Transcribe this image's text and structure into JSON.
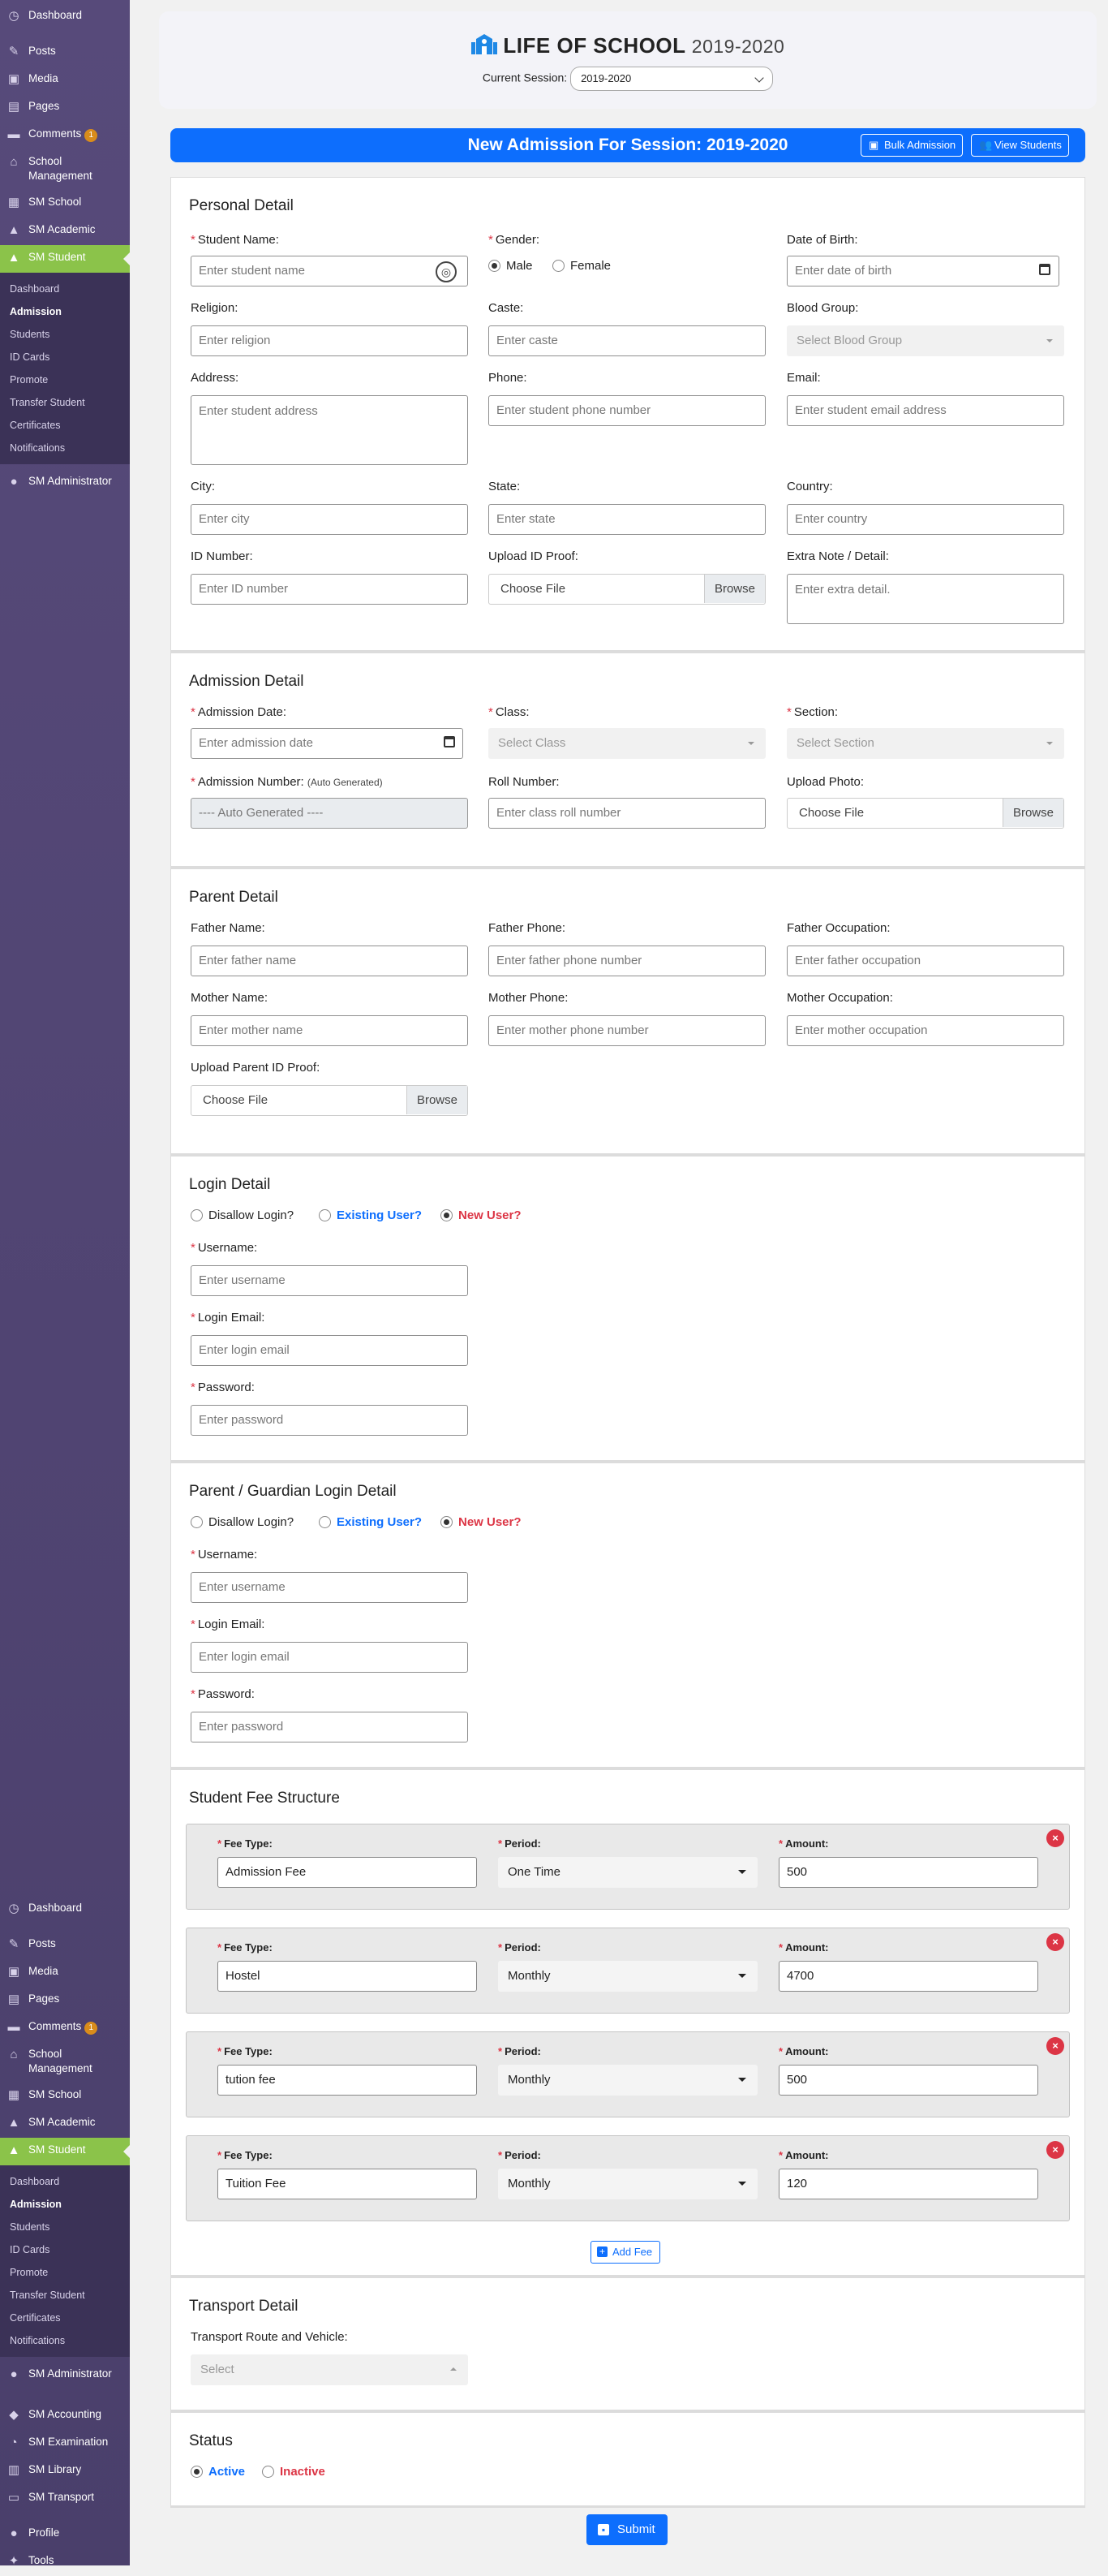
{
  "sidebar": {
    "top_items": [
      {
        "icon": "dashboard-icon",
        "label": "Dashboard"
      },
      {
        "icon": "pin-icon",
        "label": "Posts"
      },
      {
        "icon": "media-icon",
        "label": "Media"
      },
      {
        "icon": "pages-icon",
        "label": "Pages"
      },
      {
        "icon": "comments-icon",
        "label": "Comments",
        "badge": "1"
      },
      {
        "icon": "school-icon",
        "label": "School Management"
      },
      {
        "icon": "building-icon",
        "label": "SM School"
      },
      {
        "icon": "graduation-icon",
        "label": "SM Academic"
      },
      {
        "icon": "graduation-icon",
        "label": "SM Student"
      }
    ],
    "student_sub": [
      "Dashboard",
      "Admission",
      "Students",
      "ID Cards",
      "Promote",
      "Transfer Student",
      "Certificates",
      "Notifications"
    ],
    "admin": {
      "icon": "user-icon",
      "label": "SM Administrator"
    },
    "bottom_extra": [
      {
        "icon": "accounting-icon",
        "label": "SM Accounting"
      },
      {
        "icon": "clock-icon",
        "label": "SM Examination"
      },
      {
        "icon": "library-icon",
        "label": "SM Library"
      },
      {
        "icon": "bus-icon",
        "label": "SM Transport"
      },
      {
        "icon": "profile-icon",
        "label": "Profile"
      },
      {
        "icon": "wrench-icon",
        "label": "Tools"
      }
    ]
  },
  "header": {
    "school": "LIFE OF SCHOOL",
    "year": "2019-2020",
    "session_label": "Current Session:",
    "session_value": "2019-2020"
  },
  "banner": {
    "title": "New Admission For Session: 2019-2020",
    "bulk_label": "Bulk Admission",
    "view_label": "View Students"
  },
  "personal": {
    "title": "Personal Detail",
    "student_name": {
      "label": "Student Name:",
      "placeholder": "Enter student name"
    },
    "gender": {
      "label": "Gender:",
      "male": "Male",
      "female": "Female",
      "selected": "Male"
    },
    "dob": {
      "label": "Date of Birth:",
      "placeholder": "Enter date of birth"
    },
    "religion": {
      "label": "Religion:",
      "placeholder": "Enter religion"
    },
    "caste": {
      "label": "Caste:",
      "placeholder": "Enter caste"
    },
    "blood": {
      "label": "Blood Group:",
      "placeholder": "Select Blood Group"
    },
    "address": {
      "label": "Address:",
      "placeholder": "Enter student address"
    },
    "phone": {
      "label": "Phone:",
      "placeholder": "Enter student phone number"
    },
    "email": {
      "label": "Email:",
      "placeholder": "Enter student email address"
    },
    "city": {
      "label": "City:",
      "placeholder": "Enter city"
    },
    "state": {
      "label": "State:",
      "placeholder": "Enter state"
    },
    "country": {
      "label": "Country:",
      "placeholder": "Enter country"
    },
    "id_number": {
      "label": "ID Number:",
      "placeholder": "Enter ID number"
    },
    "id_proof": {
      "label": "Upload ID Proof:",
      "choose": "Choose File",
      "browse": "Browse"
    },
    "note": {
      "label": "Extra Note / Detail:",
      "placeholder": "Enter extra detail."
    }
  },
  "admission": {
    "title": "Admission Detail",
    "date": {
      "label": "Admission Date:",
      "placeholder": "Enter admission date"
    },
    "class": {
      "label": "Class:",
      "placeholder": "Select Class"
    },
    "section": {
      "label": "Section:",
      "placeholder": "Select Section"
    },
    "number": {
      "label": "Admission Number:",
      "note": "(Auto Generated)",
      "value": "---- Auto Generated ----"
    },
    "roll": {
      "label": "Roll Number:",
      "placeholder": "Enter class roll number"
    },
    "photo": {
      "label": "Upload Photo:",
      "choose": "Choose File",
      "browse": "Browse"
    }
  },
  "parent": {
    "title": "Parent Detail",
    "father_name": {
      "label": "Father Name:",
      "placeholder": "Enter father name"
    },
    "father_phone": {
      "label": "Father Phone:",
      "placeholder": "Enter father phone number"
    },
    "father_occ": {
      "label": "Father Occupation:",
      "placeholder": "Enter father occupation"
    },
    "mother_name": {
      "label": "Mother Name:",
      "placeholder": "Enter mother name"
    },
    "mother_phone": {
      "label": "Mother Phone:",
      "placeholder": "Enter mother phone number"
    },
    "mother_occ": {
      "label": "Mother Occupation:",
      "placeholder": "Enter mother occupation"
    },
    "id_proof": {
      "label": "Upload Parent ID Proof:",
      "choose": "Choose File",
      "browse": "Browse"
    }
  },
  "login": {
    "title": "Login Detail",
    "opt_disallow": "Disallow Login?",
    "opt_existing": "Existing User?",
    "opt_new": "New User?",
    "selected": "New User?",
    "username": {
      "label": "Username:",
      "placeholder": "Enter username"
    },
    "login_email": {
      "label": "Login Email:",
      "placeholder": "Enter login email"
    },
    "password": {
      "label": "Password:",
      "placeholder": "Enter password"
    }
  },
  "guardian": {
    "title": "Parent / Guardian Login Detail",
    "opt_disallow": "Disallow Login?",
    "opt_existing": "Existing User?",
    "opt_new": "New User?",
    "selected": "New User?",
    "username": {
      "label": "Username:",
      "placeholder": "Enter username"
    },
    "login_email": {
      "label": "Login Email:",
      "placeholder": "Enter login email"
    },
    "password": {
      "label": "Password:",
      "placeholder": "Enter password"
    }
  },
  "fees": {
    "title": "Student Fee Structure",
    "type_label": "Fee Type:",
    "period_label": "Period:",
    "amount_label": "Amount:",
    "rows": [
      {
        "type": "Admission Fee",
        "period": "One Time",
        "amount": "500"
      },
      {
        "type": "Hostel",
        "period": "Monthly",
        "amount": "4700"
      },
      {
        "type": "tution fee",
        "period": "Monthly",
        "amount": "500"
      },
      {
        "type": "Tuition Fee",
        "period": "Monthly",
        "amount": "120"
      }
    ],
    "add_label": "Add Fee"
  },
  "transport": {
    "title": "Transport Detail",
    "label": "Transport Route and Vehicle:",
    "placeholder": "Select"
  },
  "status": {
    "title": "Status",
    "active": "Active",
    "inactive": "Inactive",
    "selected": "Active"
  },
  "submit_label": "Submit"
}
